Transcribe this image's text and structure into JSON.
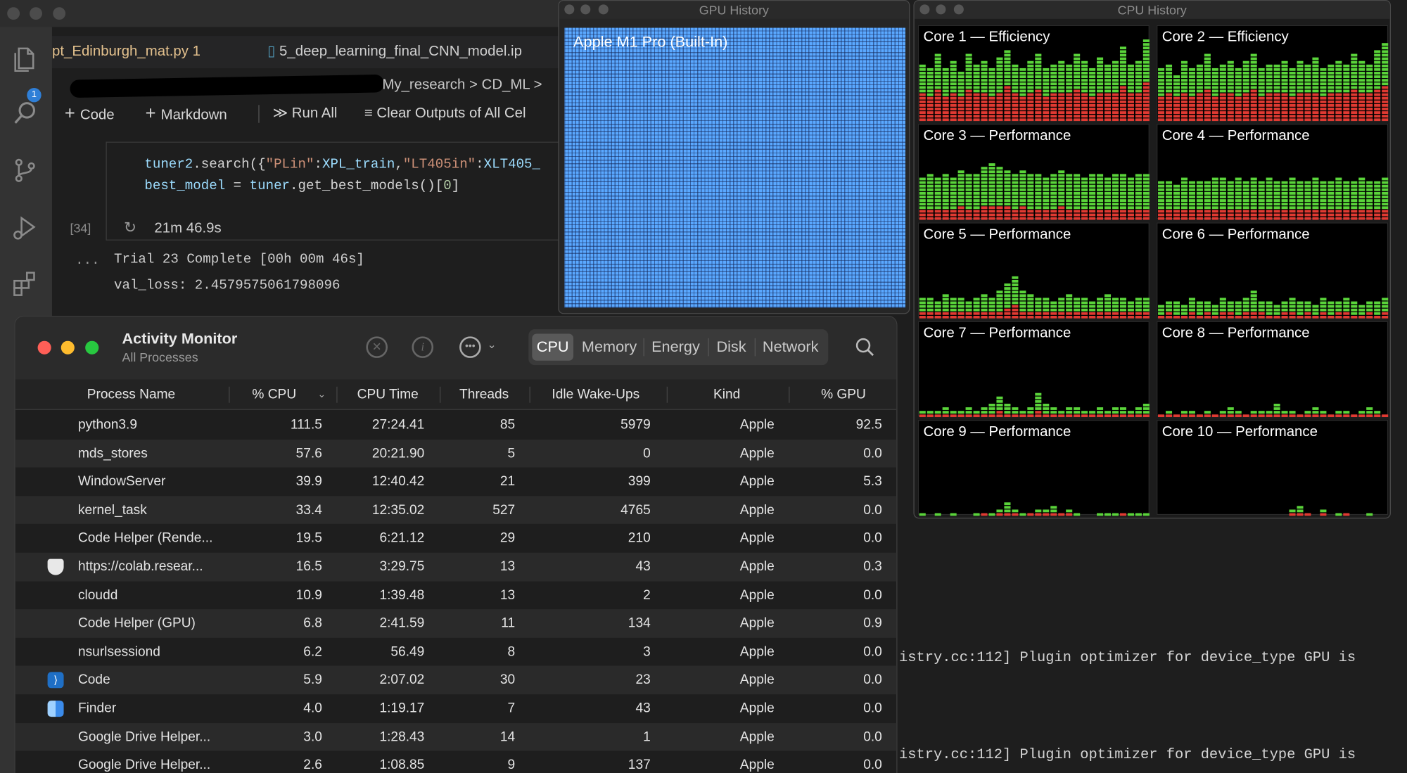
{
  "vscode": {
    "tabs": [
      "pt_Edinburgh_mat.py 1",
      "5_deep_learning_final_CNN_model.ip"
    ],
    "breadcrumb": "My_research > CD_ML >",
    "toolbar": {
      "code": "Code",
      "markdown": "Markdown",
      "run_all": "Run All",
      "clear": "Clear Outputs of All Cel"
    },
    "explorer_badge": "1",
    "code_line1": [
      {
        "t": "tuner2",
        "c": "#9cdcfe"
      },
      {
        "t": ".search({",
        "c": "#d4d4d4"
      },
      {
        "t": "\"PLin\"",
        "c": "#ce9178"
      },
      {
        "t": ":",
        "c": "#d4d4d4"
      },
      {
        "t": "XPL_train",
        "c": "#9cdcfe"
      },
      {
        "t": ",",
        "c": "#d4d4d4"
      },
      {
        "t": "\"LT405in\"",
        "c": "#ce9178"
      },
      {
        "t": ":",
        "c": "#d4d4d4"
      },
      {
        "t": "XLT405_",
        "c": "#9cdcfe"
      }
    ],
    "code_line2": [
      {
        "t": "best_model",
        "c": "#9cdcfe"
      },
      {
        "t": " = ",
        "c": "#d4d4d4"
      },
      {
        "t": "tuner",
        "c": "#9cdcfe"
      },
      {
        "t": ".get_best_models()[",
        "c": "#d4d4d4"
      },
      {
        "t": "0",
        "c": "#b5cea8"
      },
      {
        "t": "]",
        "c": "#d4d4d4"
      }
    ],
    "exec_count": "[34]",
    "exec_time": "21m 46.9s",
    "output_ellipsis": "...",
    "output_lines": [
      "Trial 23 Complete [00h 00m 46s]",
      "val_loss: 2.4579575061798096"
    ]
  },
  "gpu_window": {
    "title": "GPU History",
    "device": "Apple M1 Pro (Built-In)"
  },
  "cpu_window": {
    "title": "CPU History",
    "cores": [
      {
        "label": "Core 1 — Efficiency",
        "total": [
          0.62,
          0.55,
          0.7,
          0.58,
          0.66,
          0.52,
          0.72,
          0.6,
          0.64,
          0.57,
          0.68,
          0.74,
          0.6,
          0.55,
          0.66,
          0.7,
          0.58,
          0.62,
          0.66,
          0.6,
          0.72,
          0.64,
          0.58,
          0.68,
          0.6,
          0.64,
          0.78,
          0.6,
          0.66,
          0.86
        ],
        "system": [
          0.3,
          0.28,
          0.33,
          0.27,
          0.31,
          0.25,
          0.34,
          0.3,
          0.3,
          0.28,
          0.32,
          0.36,
          0.29,
          0.27,
          0.31,
          0.33,
          0.28,
          0.3,
          0.31,
          0.29,
          0.34,
          0.31,
          0.28,
          0.32,
          0.29,
          0.31,
          0.37,
          0.29,
          0.32,
          0.4
        ]
      },
      {
        "label": "Core 2 — Efficiency",
        "total": [
          0.55,
          0.6,
          0.5,
          0.66,
          0.58,
          0.62,
          0.7,
          0.56,
          0.6,
          0.66,
          0.58,
          0.64,
          0.7,
          0.56,
          0.62,
          0.6,
          0.66,
          0.58,
          0.64,
          0.6,
          0.68,
          0.56,
          0.62,
          0.66,
          0.6,
          0.7,
          0.64,
          0.6,
          0.74,
          0.84
        ],
        "system": [
          0.27,
          0.29,
          0.25,
          0.32,
          0.28,
          0.3,
          0.33,
          0.27,
          0.29,
          0.31,
          0.28,
          0.3,
          0.33,
          0.27,
          0.3,
          0.29,
          0.31,
          0.28,
          0.3,
          0.29,
          0.32,
          0.27,
          0.3,
          0.31,
          0.29,
          0.33,
          0.3,
          0.29,
          0.34,
          0.39
        ]
      },
      {
        "label": "Core 3 — Performance",
        "total": [
          0.46,
          0.48,
          0.44,
          0.5,
          0.46,
          0.52,
          0.48,
          0.5,
          0.56,
          0.6,
          0.58,
          0.54,
          0.5,
          0.52,
          0.48,
          0.5,
          0.46,
          0.48,
          0.52,
          0.5,
          0.48,
          0.46,
          0.5,
          0.48,
          0.46,
          0.5,
          0.48,
          0.46,
          0.5,
          0.48
        ],
        "system": [
          0.13,
          0.12,
          0.12,
          0.13,
          0.12,
          0.14,
          0.13,
          0.13,
          0.15,
          0.16,
          0.15,
          0.14,
          0.13,
          0.14,
          0.13,
          0.13,
          0.12,
          0.13,
          0.14,
          0.13,
          0.13,
          0.12,
          0.13,
          0.13,
          0.12,
          0.13,
          0.13,
          0.12,
          0.13,
          0.13
        ]
      },
      {
        "label": "Core 4 — Performance",
        "total": [
          0.4,
          0.42,
          0.38,
          0.44,
          0.4,
          0.42,
          0.4,
          0.44,
          0.46,
          0.42,
          0.44,
          0.4,
          0.46,
          0.42,
          0.44,
          0.4,
          0.42,
          0.44,
          0.4,
          0.42,
          0.46,
          0.4,
          0.42,
          0.44,
          0.4,
          0.42,
          0.44,
          0.4,
          0.42,
          0.46
        ],
        "system": [
          0.11,
          0.12,
          0.1,
          0.12,
          0.11,
          0.12,
          0.11,
          0.12,
          0.13,
          0.12,
          0.12,
          0.11,
          0.13,
          0.12,
          0.12,
          0.11,
          0.12,
          0.12,
          0.11,
          0.12,
          0.13,
          0.11,
          0.12,
          0.12,
          0.11,
          0.12,
          0.12,
          0.11,
          0.12,
          0.13
        ]
      },
      {
        "label": "Core 5 — Performance",
        "total": [
          0.22,
          0.24,
          0.2,
          0.26,
          0.22,
          0.24,
          0.2,
          0.22,
          0.26,
          0.24,
          0.3,
          0.36,
          0.46,
          0.32,
          0.26,
          0.22,
          0.24,
          0.2,
          0.22,
          0.26,
          0.24,
          0.22,
          0.2,
          0.24,
          0.26,
          0.22,
          0.24,
          0.2,
          0.22,
          0.24
        ],
        "system": [
          0.06,
          0.07,
          0.06,
          0.07,
          0.06,
          0.07,
          0.06,
          0.06,
          0.07,
          0.07,
          0.08,
          0.1,
          0.14,
          0.09,
          0.07,
          0.06,
          0.07,
          0.06,
          0.06,
          0.07,
          0.07,
          0.06,
          0.06,
          0.07,
          0.07,
          0.06,
          0.07,
          0.06,
          0.06,
          0.07
        ]
      },
      {
        "label": "Core 6 — Performance",
        "total": [
          0.16,
          0.2,
          0.18,
          0.14,
          0.22,
          0.18,
          0.2,
          0.16,
          0.24,
          0.2,
          0.18,
          0.22,
          0.3,
          0.2,
          0.18,
          0.16,
          0.2,
          0.24,
          0.18,
          0.2,
          0.16,
          0.22,
          0.18,
          0.2,
          0.24,
          0.18,
          0.16,
          0.2,
          0.18,
          0.22
        ],
        "system": [
          0.05,
          0.06,
          0.05,
          0.05,
          0.06,
          0.05,
          0.06,
          0.05,
          0.07,
          0.06,
          0.05,
          0.06,
          0.08,
          0.06,
          0.05,
          0.05,
          0.06,
          0.07,
          0.05,
          0.06,
          0.05,
          0.06,
          0.05,
          0.06,
          0.07,
          0.05,
          0.05,
          0.06,
          0.05,
          0.06
        ]
      },
      {
        "label": "Core 7 — Performance",
        "total": [
          0.06,
          0.08,
          0.06,
          0.1,
          0.06,
          0.08,
          0.12,
          0.08,
          0.1,
          0.14,
          0.24,
          0.16,
          0.1,
          0.08,
          0.12,
          0.26,
          0.14,
          0.1,
          0.08,
          0.12,
          0.1,
          0.08,
          0.06,
          0.1,
          0.08,
          0.12,
          0.1,
          0.08,
          0.1,
          0.16
        ],
        "system": [
          0.03,
          0.03,
          0.03,
          0.04,
          0.03,
          0.03,
          0.04,
          0.03,
          0.04,
          0.05,
          0.07,
          0.05,
          0.04,
          0.03,
          0.04,
          0.07,
          0.05,
          0.04,
          0.03,
          0.04,
          0.04,
          0.03,
          0.03,
          0.04,
          0.03,
          0.04,
          0.04,
          0.03,
          0.04,
          0.05
        ]
      },
      {
        "label": "Core 8 — Performance",
        "total": [
          0.04,
          0.06,
          0.04,
          0.06,
          0.08,
          0.04,
          0.06,
          0.04,
          0.06,
          0.1,
          0.06,
          0.04,
          0.06,
          0.08,
          0.06,
          0.16,
          0.08,
          0.06,
          0.04,
          0.06,
          0.12,
          0.06,
          0.04,
          0.06,
          0.08,
          0.04,
          0.06,
          0.1,
          0.06,
          0.04
        ],
        "system": [
          0.02,
          0.03,
          0.02,
          0.03,
          0.03,
          0.02,
          0.03,
          0.02,
          0.03,
          0.04,
          0.03,
          0.02,
          0.03,
          0.03,
          0.03,
          0.05,
          0.03,
          0.03,
          0.02,
          0.03,
          0.04,
          0.03,
          0.02,
          0.03,
          0.03,
          0.02,
          0.03,
          0.04,
          0.03,
          0.02
        ]
      },
      {
        "label": "Core 9 — Performance",
        "total": [
          0.02,
          0.0,
          0.03,
          0.0,
          0.02,
          0.0,
          0.0,
          0.02,
          0.04,
          0.02,
          0.08,
          0.14,
          0.06,
          0.02,
          0.04,
          0.08,
          0.06,
          0.1,
          0.04,
          0.06,
          0.02,
          0.0,
          0.0,
          0.02,
          0.03,
          0.02,
          0.04,
          0.02,
          0.03,
          0.02
        ],
        "system": [
          0.01,
          0.0,
          0.01,
          0.0,
          0.01,
          0.0,
          0.0,
          0.01,
          0.02,
          0.01,
          0.03,
          0.04,
          0.02,
          0.01,
          0.02,
          0.03,
          0.02,
          0.03,
          0.02,
          0.02,
          0.01,
          0.0,
          0.0,
          0.01,
          0.01,
          0.01,
          0.02,
          0.01,
          0.01,
          0.01
        ]
      },
      {
        "label": "Core 10 — Performance",
        "total": [
          0.0,
          0.0,
          0.0,
          0.0,
          0.0,
          0.0,
          0.0,
          0.0,
          0.0,
          0.0,
          0.0,
          0.0,
          0.0,
          0.0,
          0.0,
          0.0,
          0.0,
          0.06,
          0.1,
          0.04,
          0.0,
          0.06,
          0.0,
          0.02,
          0.04,
          0.0,
          0.0,
          0.02,
          0.0,
          0.0
        ],
        "system": [
          0.0,
          0.0,
          0.0,
          0.0,
          0.0,
          0.0,
          0.0,
          0.0,
          0.0,
          0.0,
          0.0,
          0.0,
          0.0,
          0.0,
          0.0,
          0.0,
          0.0,
          0.02,
          0.03,
          0.02,
          0.0,
          0.02,
          0.0,
          0.01,
          0.02,
          0.0,
          0.0,
          0.01,
          0.0,
          0.0
        ]
      }
    ],
    "colors": {
      "user": "#5ad43a",
      "system": "#e03a32"
    }
  },
  "terminal_lines": [
    "istry.cc:112] Plugin optimizer for device_type GPU is",
    "istry.cc:112] Plugin optimizer for device_type GPU is"
  ],
  "activity_monitor": {
    "title": "Activity Monitor",
    "subtitle": "All Processes",
    "tabs": [
      "CPU",
      "Memory",
      "Energy",
      "Disk",
      "Network"
    ],
    "columns": [
      "Process Name",
      "% CPU",
      "CPU Time",
      "Threads",
      "Idle Wake-Ups",
      "Kind",
      "% GPU"
    ],
    "processes": [
      {
        "icon": "",
        "name": "python3.9",
        "cpu": "111.5",
        "time": "27:24.41",
        "threads": "85",
        "wakeups": "5979",
        "kind": "Apple",
        "gpu": "92.5"
      },
      {
        "icon": "",
        "name": "mds_stores",
        "cpu": "57.6",
        "time": "20:21.90",
        "threads": "5",
        "wakeups": "0",
        "kind": "Apple",
        "gpu": "0.0"
      },
      {
        "icon": "",
        "name": "WindowServer",
        "cpu": "39.9",
        "time": "12:40.42",
        "threads": "21",
        "wakeups": "399",
        "kind": "Apple",
        "gpu": "5.3"
      },
      {
        "icon": "",
        "name": "kernel_task",
        "cpu": "33.4",
        "time": "12:35.02",
        "threads": "527",
        "wakeups": "4765",
        "kind": "Apple",
        "gpu": "0.0"
      },
      {
        "icon": "",
        "name": "Code Helper (Rende...",
        "cpu": "19.5",
        "time": "6:21.12",
        "threads": "29",
        "wakeups": "210",
        "kind": "Apple",
        "gpu": "0.0"
      },
      {
        "icon": "shield-icon",
        "name": "https://colab.resear...",
        "cpu": "16.5",
        "time": "3:29.75",
        "threads": "13",
        "wakeups": "43",
        "kind": "Apple",
        "gpu": "0.3"
      },
      {
        "icon": "",
        "name": "cloudd",
        "cpu": "10.9",
        "time": "1:39.48",
        "threads": "13",
        "wakeups": "2",
        "kind": "Apple",
        "gpu": "0.0"
      },
      {
        "icon": "",
        "name": "Code Helper (GPU)",
        "cpu": "6.8",
        "time": "2:41.59",
        "threads": "11",
        "wakeups": "134",
        "kind": "Apple",
        "gpu": "0.9"
      },
      {
        "icon": "",
        "name": "nsurlsessiond",
        "cpu": "6.2",
        "time": "56.49",
        "threads": "8",
        "wakeups": "3",
        "kind": "Apple",
        "gpu": "0.0"
      },
      {
        "icon": "vscode-icon",
        "name": "Code",
        "cpu": "5.9",
        "time": "2:07.02",
        "threads": "30",
        "wakeups": "23",
        "kind": "Apple",
        "gpu": "0.0"
      },
      {
        "icon": "finder-icon",
        "name": "Finder",
        "cpu": "4.0",
        "time": "1:19.17",
        "threads": "7",
        "wakeups": "43",
        "kind": "Apple",
        "gpu": "0.0"
      },
      {
        "icon": "",
        "name": "Google Drive Helper...",
        "cpu": "3.0",
        "time": "1:28.43",
        "threads": "14",
        "wakeups": "1",
        "kind": "Apple",
        "gpu": "0.0"
      },
      {
        "icon": "",
        "name": "Google Drive Helper...",
        "cpu": "2.6",
        "time": "1:08.85",
        "threads": "9",
        "wakeups": "137",
        "kind": "Apple",
        "gpu": "0.0"
      }
    ]
  }
}
